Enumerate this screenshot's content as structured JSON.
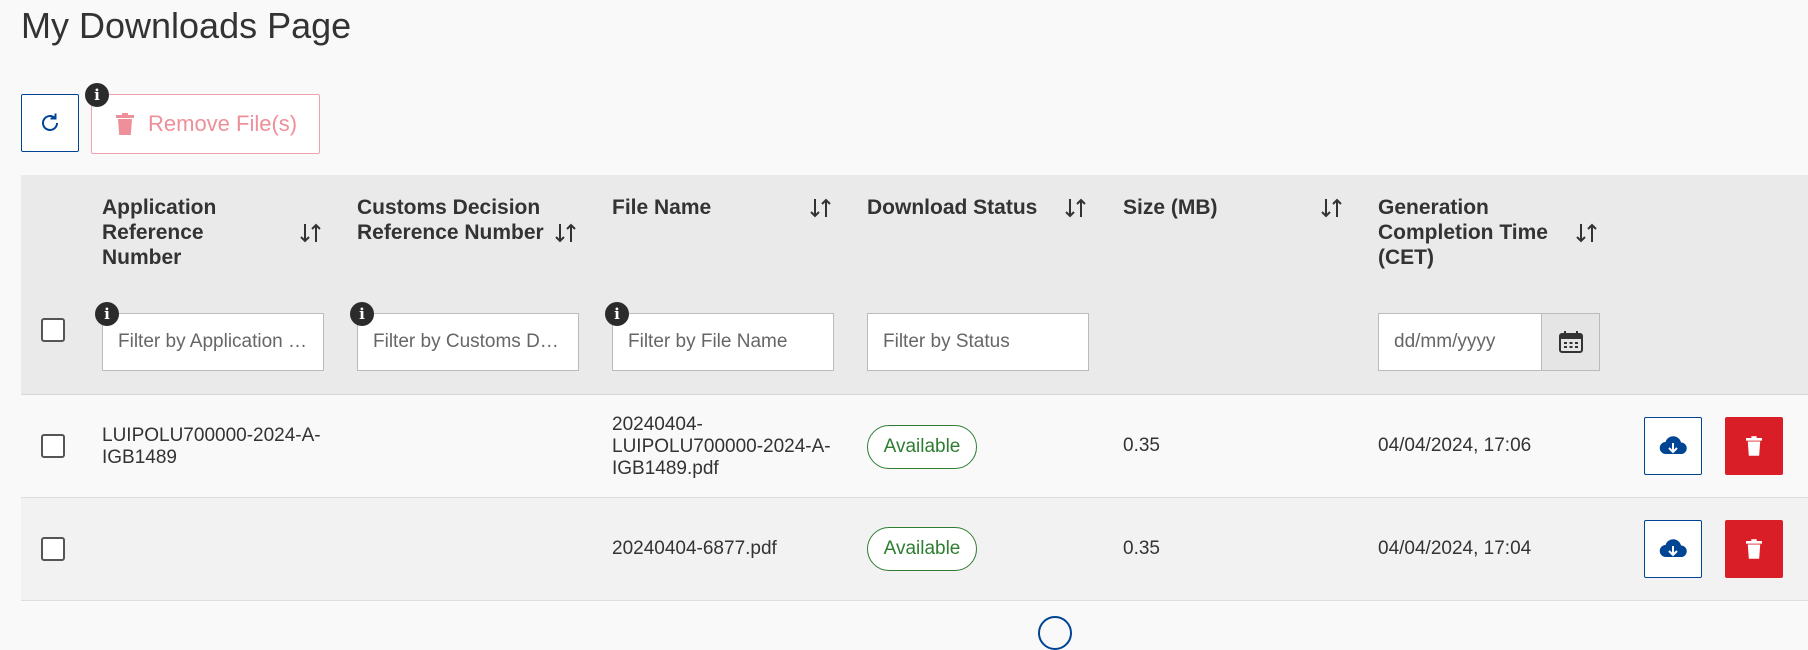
{
  "page": {
    "title": "My Downloads Page"
  },
  "toolbar": {
    "refresh_icon": "refresh-icon",
    "remove_label": "Remove File(s)",
    "remove_icon": "trash-icon",
    "info_icon": "info-icon"
  },
  "table": {
    "columns": [
      {
        "label": "Application Reference Number",
        "sortable": true
      },
      {
        "label": "Customs Decision Reference Number",
        "sortable": true
      },
      {
        "label": "File Name",
        "sortable": true
      },
      {
        "label": "Download Status",
        "sortable": true
      },
      {
        "label": "Size (MB)",
        "sortable": true
      },
      {
        "label": "Generation Completion Time (CET)",
        "sortable": true
      }
    ],
    "filters": {
      "application": {
        "placeholder": "Filter by Application …",
        "value": ""
      },
      "customs": {
        "placeholder": "Filter by Customs D…",
        "value": ""
      },
      "file": {
        "placeholder": "Filter by File Name",
        "value": ""
      },
      "status": {
        "placeholder": "Filter by Status",
        "value": ""
      },
      "date": {
        "placeholder": "dd/mm/yyyy",
        "value": ""
      }
    },
    "rows": [
      {
        "app_ref": "LUIPOLU700000-2024-A-IGB1489",
        "customs_ref": "",
        "file_name": "20240404-LUIPOLU700000-2024-A-IGB1489.pdf",
        "status": "Available",
        "size": "0.35",
        "time": "04/04/2024, 17:06"
      },
      {
        "app_ref": "",
        "customs_ref": "",
        "file_name": "20240404-6877.pdf",
        "status": "Available",
        "size": "0.35",
        "time": "04/04/2024, 17:04"
      }
    ]
  },
  "colors": {
    "primary": "#004494",
    "danger": "#da1e28",
    "success": "#2e7d32",
    "header_bg": "#eaeaea"
  }
}
